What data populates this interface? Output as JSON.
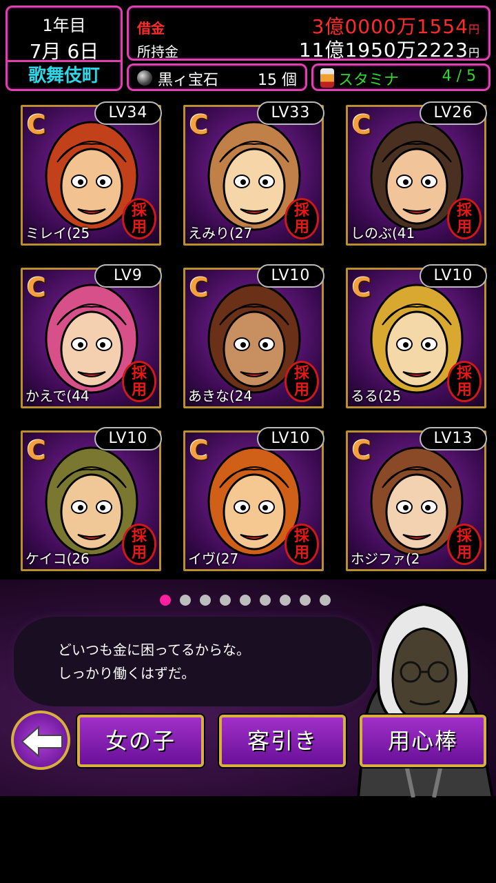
{
  "status": {
    "year": "1年目",
    "date": "7月 6日",
    "town": "歌舞伎町",
    "debt_label": "借金",
    "debt_value": "3億0000万1554",
    "cash_label": "所持金",
    "cash_value": "11億1950万2223",
    "yen": "円",
    "gem_label": "黒ィ宝石",
    "gem_count": "15 個",
    "stamina_label": "スタミナ",
    "stamina_value": "4 / 5"
  },
  "cards": [
    {
      "rank": "C",
      "level": "LV34",
      "name": "ミレイ(25",
      "stamp": "採用",
      "hair": "#c2401a",
      "skin": "#f2c290"
    },
    {
      "rank": "C",
      "level": "LV33",
      "name": "えみり(27",
      "stamp": "採用",
      "hair": "#c08048",
      "skin": "#f6d6a8"
    },
    {
      "rank": "C",
      "level": "LV26",
      "name": "しのぶ(41",
      "stamp": "採用",
      "hair": "#4a3020",
      "skin": "#f2c49a"
    },
    {
      "rank": "C",
      "level": "LV9",
      "name": "かえで(44",
      "stamp": "採用",
      "hair": "#d8508a",
      "skin": "#f4d0b0"
    },
    {
      "rank": "C",
      "level": "LV10",
      "name": "あきな(24",
      "stamp": "採用",
      "hair": "#6a3018",
      "skin": "#c89060"
    },
    {
      "rank": "C",
      "level": "LV10",
      "name": "るる(25",
      "stamp": "採用",
      "hair": "#d8a830",
      "skin": "#f4d8a8"
    },
    {
      "rank": "C",
      "level": "LV10",
      "name": "ケイコ(26",
      "stamp": "採用",
      "hair": "#7a7830",
      "skin": "#f0c898"
    },
    {
      "rank": "C",
      "level": "LV10",
      "name": "イヴ(27",
      "stamp": "採用",
      "hair": "#d06018",
      "skin": "#f4c890"
    },
    {
      "rank": "C",
      "level": "LV13",
      "name": "ホジファ(2",
      "stamp": "採用",
      "hair": "#8a4a28",
      "skin": "#f2d2b0"
    }
  ],
  "pager": {
    "count": 9,
    "active": 0
  },
  "dialogue": {
    "line1": "どいつも金に困ってるからな。",
    "line2": "しっかり働くはずだ。"
  },
  "buttons": {
    "back": "back-arrow-icon",
    "girls": "女の子",
    "tout": "客引き",
    "guard": "用心棒"
  },
  "colors": {
    "frame": "#e040b0",
    "debt": "#ff2a2a",
    "town": "#2fd6e8",
    "stamina": "#2fd82f",
    "gold": "#d8b040"
  }
}
